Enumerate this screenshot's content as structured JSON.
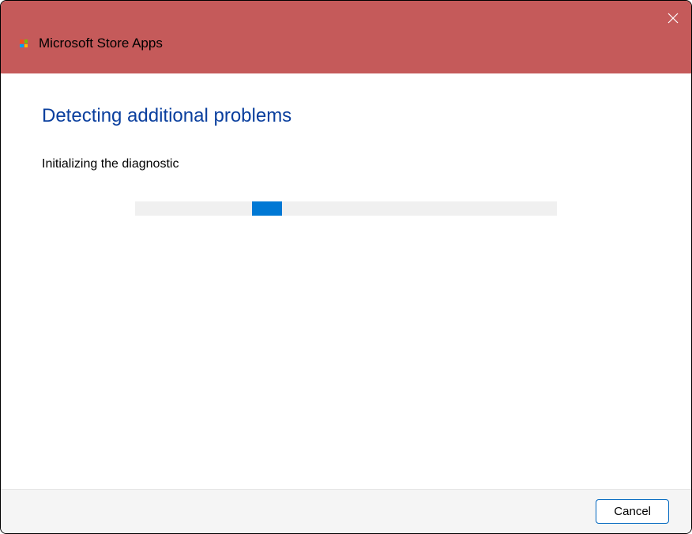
{
  "titlebar": {
    "app_name": "Microsoft Store Apps"
  },
  "content": {
    "heading": "Detecting additional problems",
    "status": "Initializing the diagnostic"
  },
  "footer": {
    "cancel_label": "Cancel"
  },
  "colors": {
    "titlebar_bg": "#c55a5a",
    "heading_color": "#0a3f9e",
    "progress_accent": "#0078d4"
  }
}
